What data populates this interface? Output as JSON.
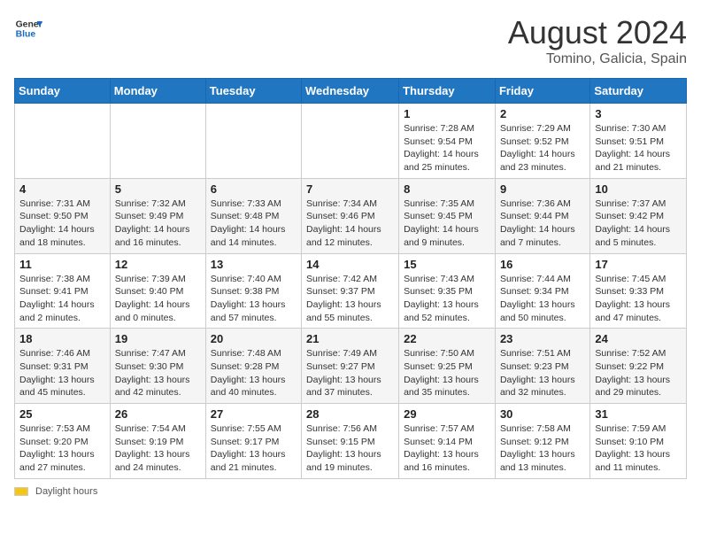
{
  "header": {
    "logo_general": "General",
    "logo_blue": "Blue",
    "month_year": "August 2024",
    "location": "Tomino, Galicia, Spain"
  },
  "days_of_week": [
    "Sunday",
    "Monday",
    "Tuesday",
    "Wednesday",
    "Thursday",
    "Friday",
    "Saturday"
  ],
  "weeks": [
    [
      {
        "day": "",
        "info": ""
      },
      {
        "day": "",
        "info": ""
      },
      {
        "day": "",
        "info": ""
      },
      {
        "day": "",
        "info": ""
      },
      {
        "day": "1",
        "info": "Sunrise: 7:28 AM\nSunset: 9:54 PM\nDaylight: 14 hours and 25 minutes."
      },
      {
        "day": "2",
        "info": "Sunrise: 7:29 AM\nSunset: 9:52 PM\nDaylight: 14 hours and 23 minutes."
      },
      {
        "day": "3",
        "info": "Sunrise: 7:30 AM\nSunset: 9:51 PM\nDaylight: 14 hours and 21 minutes."
      }
    ],
    [
      {
        "day": "4",
        "info": "Sunrise: 7:31 AM\nSunset: 9:50 PM\nDaylight: 14 hours and 18 minutes."
      },
      {
        "day": "5",
        "info": "Sunrise: 7:32 AM\nSunset: 9:49 PM\nDaylight: 14 hours and 16 minutes."
      },
      {
        "day": "6",
        "info": "Sunrise: 7:33 AM\nSunset: 9:48 PM\nDaylight: 14 hours and 14 minutes."
      },
      {
        "day": "7",
        "info": "Sunrise: 7:34 AM\nSunset: 9:46 PM\nDaylight: 14 hours and 12 minutes."
      },
      {
        "day": "8",
        "info": "Sunrise: 7:35 AM\nSunset: 9:45 PM\nDaylight: 14 hours and 9 minutes."
      },
      {
        "day": "9",
        "info": "Sunrise: 7:36 AM\nSunset: 9:44 PM\nDaylight: 14 hours and 7 minutes."
      },
      {
        "day": "10",
        "info": "Sunrise: 7:37 AM\nSunset: 9:42 PM\nDaylight: 14 hours and 5 minutes."
      }
    ],
    [
      {
        "day": "11",
        "info": "Sunrise: 7:38 AM\nSunset: 9:41 PM\nDaylight: 14 hours and 2 minutes."
      },
      {
        "day": "12",
        "info": "Sunrise: 7:39 AM\nSunset: 9:40 PM\nDaylight: 14 hours and 0 minutes."
      },
      {
        "day": "13",
        "info": "Sunrise: 7:40 AM\nSunset: 9:38 PM\nDaylight: 13 hours and 57 minutes."
      },
      {
        "day": "14",
        "info": "Sunrise: 7:42 AM\nSunset: 9:37 PM\nDaylight: 13 hours and 55 minutes."
      },
      {
        "day": "15",
        "info": "Sunrise: 7:43 AM\nSunset: 9:35 PM\nDaylight: 13 hours and 52 minutes."
      },
      {
        "day": "16",
        "info": "Sunrise: 7:44 AM\nSunset: 9:34 PM\nDaylight: 13 hours and 50 minutes."
      },
      {
        "day": "17",
        "info": "Sunrise: 7:45 AM\nSunset: 9:33 PM\nDaylight: 13 hours and 47 minutes."
      }
    ],
    [
      {
        "day": "18",
        "info": "Sunrise: 7:46 AM\nSunset: 9:31 PM\nDaylight: 13 hours and 45 minutes."
      },
      {
        "day": "19",
        "info": "Sunrise: 7:47 AM\nSunset: 9:30 PM\nDaylight: 13 hours and 42 minutes."
      },
      {
        "day": "20",
        "info": "Sunrise: 7:48 AM\nSunset: 9:28 PM\nDaylight: 13 hours and 40 minutes."
      },
      {
        "day": "21",
        "info": "Sunrise: 7:49 AM\nSunset: 9:27 PM\nDaylight: 13 hours and 37 minutes."
      },
      {
        "day": "22",
        "info": "Sunrise: 7:50 AM\nSunset: 9:25 PM\nDaylight: 13 hours and 35 minutes."
      },
      {
        "day": "23",
        "info": "Sunrise: 7:51 AM\nSunset: 9:23 PM\nDaylight: 13 hours and 32 minutes."
      },
      {
        "day": "24",
        "info": "Sunrise: 7:52 AM\nSunset: 9:22 PM\nDaylight: 13 hours and 29 minutes."
      }
    ],
    [
      {
        "day": "25",
        "info": "Sunrise: 7:53 AM\nSunset: 9:20 PM\nDaylight: 13 hours and 27 minutes."
      },
      {
        "day": "26",
        "info": "Sunrise: 7:54 AM\nSunset: 9:19 PM\nDaylight: 13 hours and 24 minutes."
      },
      {
        "day": "27",
        "info": "Sunrise: 7:55 AM\nSunset: 9:17 PM\nDaylight: 13 hours and 21 minutes."
      },
      {
        "day": "28",
        "info": "Sunrise: 7:56 AM\nSunset: 9:15 PM\nDaylight: 13 hours and 19 minutes."
      },
      {
        "day": "29",
        "info": "Sunrise: 7:57 AM\nSunset: 9:14 PM\nDaylight: 13 hours and 16 minutes."
      },
      {
        "day": "30",
        "info": "Sunrise: 7:58 AM\nSunset: 9:12 PM\nDaylight: 13 hours and 13 minutes."
      },
      {
        "day": "31",
        "info": "Sunrise: 7:59 AM\nSunset: 9:10 PM\nDaylight: 13 hours and 11 minutes."
      }
    ]
  ],
  "footer": {
    "daylight_label": "Daylight hours"
  }
}
